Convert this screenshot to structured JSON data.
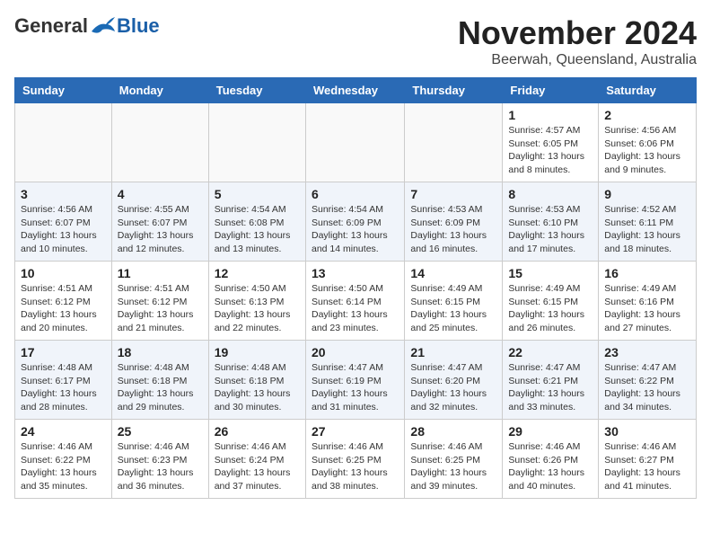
{
  "header": {
    "logo_general": "General",
    "logo_blue": "Blue",
    "month": "November 2024",
    "location": "Beerwah, Queensland, Australia"
  },
  "weekdays": [
    "Sunday",
    "Monday",
    "Tuesday",
    "Wednesday",
    "Thursday",
    "Friday",
    "Saturday"
  ],
  "weeks": [
    [
      {
        "day": "",
        "info": ""
      },
      {
        "day": "",
        "info": ""
      },
      {
        "day": "",
        "info": ""
      },
      {
        "day": "",
        "info": ""
      },
      {
        "day": "",
        "info": ""
      },
      {
        "day": "1",
        "info": "Sunrise: 4:57 AM\nSunset: 6:05 PM\nDaylight: 13 hours and 8 minutes."
      },
      {
        "day": "2",
        "info": "Sunrise: 4:56 AM\nSunset: 6:06 PM\nDaylight: 13 hours and 9 minutes."
      }
    ],
    [
      {
        "day": "3",
        "info": "Sunrise: 4:56 AM\nSunset: 6:07 PM\nDaylight: 13 hours and 10 minutes."
      },
      {
        "day": "4",
        "info": "Sunrise: 4:55 AM\nSunset: 6:07 PM\nDaylight: 13 hours and 12 minutes."
      },
      {
        "day": "5",
        "info": "Sunrise: 4:54 AM\nSunset: 6:08 PM\nDaylight: 13 hours and 13 minutes."
      },
      {
        "day": "6",
        "info": "Sunrise: 4:54 AM\nSunset: 6:09 PM\nDaylight: 13 hours and 14 minutes."
      },
      {
        "day": "7",
        "info": "Sunrise: 4:53 AM\nSunset: 6:09 PM\nDaylight: 13 hours and 16 minutes."
      },
      {
        "day": "8",
        "info": "Sunrise: 4:53 AM\nSunset: 6:10 PM\nDaylight: 13 hours and 17 minutes."
      },
      {
        "day": "9",
        "info": "Sunrise: 4:52 AM\nSunset: 6:11 PM\nDaylight: 13 hours and 18 minutes."
      }
    ],
    [
      {
        "day": "10",
        "info": "Sunrise: 4:51 AM\nSunset: 6:12 PM\nDaylight: 13 hours and 20 minutes."
      },
      {
        "day": "11",
        "info": "Sunrise: 4:51 AM\nSunset: 6:12 PM\nDaylight: 13 hours and 21 minutes."
      },
      {
        "day": "12",
        "info": "Sunrise: 4:50 AM\nSunset: 6:13 PM\nDaylight: 13 hours and 22 minutes."
      },
      {
        "day": "13",
        "info": "Sunrise: 4:50 AM\nSunset: 6:14 PM\nDaylight: 13 hours and 23 minutes."
      },
      {
        "day": "14",
        "info": "Sunrise: 4:49 AM\nSunset: 6:15 PM\nDaylight: 13 hours and 25 minutes."
      },
      {
        "day": "15",
        "info": "Sunrise: 4:49 AM\nSunset: 6:15 PM\nDaylight: 13 hours and 26 minutes."
      },
      {
        "day": "16",
        "info": "Sunrise: 4:49 AM\nSunset: 6:16 PM\nDaylight: 13 hours and 27 minutes."
      }
    ],
    [
      {
        "day": "17",
        "info": "Sunrise: 4:48 AM\nSunset: 6:17 PM\nDaylight: 13 hours and 28 minutes."
      },
      {
        "day": "18",
        "info": "Sunrise: 4:48 AM\nSunset: 6:18 PM\nDaylight: 13 hours and 29 minutes."
      },
      {
        "day": "19",
        "info": "Sunrise: 4:48 AM\nSunset: 6:18 PM\nDaylight: 13 hours and 30 minutes."
      },
      {
        "day": "20",
        "info": "Sunrise: 4:47 AM\nSunset: 6:19 PM\nDaylight: 13 hours and 31 minutes."
      },
      {
        "day": "21",
        "info": "Sunrise: 4:47 AM\nSunset: 6:20 PM\nDaylight: 13 hours and 32 minutes."
      },
      {
        "day": "22",
        "info": "Sunrise: 4:47 AM\nSunset: 6:21 PM\nDaylight: 13 hours and 33 minutes."
      },
      {
        "day": "23",
        "info": "Sunrise: 4:47 AM\nSunset: 6:22 PM\nDaylight: 13 hours and 34 minutes."
      }
    ],
    [
      {
        "day": "24",
        "info": "Sunrise: 4:46 AM\nSunset: 6:22 PM\nDaylight: 13 hours and 35 minutes."
      },
      {
        "day": "25",
        "info": "Sunrise: 4:46 AM\nSunset: 6:23 PM\nDaylight: 13 hours and 36 minutes."
      },
      {
        "day": "26",
        "info": "Sunrise: 4:46 AM\nSunset: 6:24 PM\nDaylight: 13 hours and 37 minutes."
      },
      {
        "day": "27",
        "info": "Sunrise: 4:46 AM\nSunset: 6:25 PM\nDaylight: 13 hours and 38 minutes."
      },
      {
        "day": "28",
        "info": "Sunrise: 4:46 AM\nSunset: 6:25 PM\nDaylight: 13 hours and 39 minutes."
      },
      {
        "day": "29",
        "info": "Sunrise: 4:46 AM\nSunset: 6:26 PM\nDaylight: 13 hours and 40 minutes."
      },
      {
        "day": "30",
        "info": "Sunrise: 4:46 AM\nSunset: 6:27 PM\nDaylight: 13 hours and 41 minutes."
      }
    ]
  ]
}
